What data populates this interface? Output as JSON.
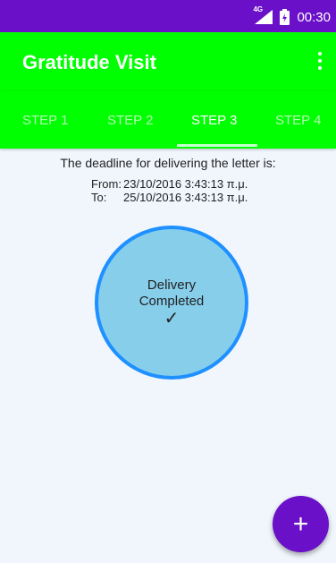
{
  "status_bar": {
    "network": "4G",
    "time": "00:30",
    "icons": [
      "signal-icon",
      "battery-icon"
    ]
  },
  "app_bar": {
    "title": "Gratitude Visit",
    "menu_icon": "overflow-menu-icon"
  },
  "tabs": [
    {
      "label": "STEP 1",
      "active": false
    },
    {
      "label": "STEP 2",
      "active": false
    },
    {
      "label": "STEP 3",
      "active": true
    },
    {
      "label": "STEP 4",
      "active": false
    }
  ],
  "main": {
    "deadline_text": "The deadline for delivering the letter is:",
    "from_label": "From:",
    "from_value": "23/10/2016 3:43:13 π.μ.",
    "to_label": "To:",
    "to_value": "25/10/2016 3:43:13 π.μ.",
    "status_line1": "Delivery",
    "status_line2": "Completed",
    "status_check": "✓"
  },
  "fab": {
    "label": "+",
    "icon": "add-icon"
  },
  "colors": {
    "primary": "#00ff00",
    "accent": "#6a10c8",
    "circle_fill": "#87ceeb",
    "circle_border": "#1e90ff",
    "background": "#f1f6fd"
  }
}
